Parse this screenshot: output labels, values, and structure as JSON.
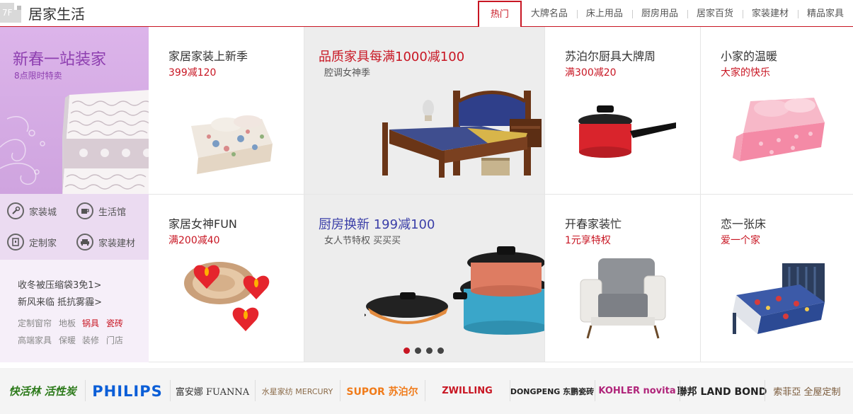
{
  "header": {
    "floor_label": "7F",
    "title": "居家生活",
    "tabs": [
      "热门",
      "大牌名品",
      "床上用品",
      "厨房用品",
      "居家百货",
      "家装建材",
      "精品家具"
    ]
  },
  "left_panel": {
    "banner_title": "新春一站装家",
    "banner_subtitle": "8点限时特卖",
    "icon_links": [
      {
        "label": "家装城",
        "icon": "wrench-icon"
      },
      {
        "label": "生活馆",
        "icon": "cup-icon"
      },
      {
        "label": "定制家",
        "icon": "door-icon"
      },
      {
        "label": "家装建材",
        "icon": "sofa-icon"
      }
    ],
    "promo_links": [
      "收冬被压缩袋3免1>",
      "新风来临 抵抗雾霾>"
    ],
    "small_links": [
      {
        "label": "定制窗帘",
        "highlight": false
      },
      {
        "label": "地板",
        "highlight": false
      },
      {
        "label": "锅具",
        "highlight": true
      },
      {
        "label": "瓷砖",
        "highlight": true
      },
      {
        "label": "高端家具",
        "highlight": false
      },
      {
        "label": "保暖",
        "highlight": false
      },
      {
        "label": "装修",
        "highlight": false
      },
      {
        "label": "门店",
        "highlight": false
      }
    ]
  },
  "products": {
    "bedding_promo": {
      "title": "家居家装上新季",
      "subtitle": "399减120",
      "image": "bedding-image"
    },
    "furniture_promo": {
      "title": "品质家具每满1000减100",
      "subtitle": "腔调女神季",
      "image": "bed-image"
    },
    "supor_promo": {
      "title": "苏泊尔厨具大牌周",
      "subtitle": "满300减20",
      "image": "saucepan-image"
    },
    "home_warm_promo": {
      "title": "小家的温暖",
      "subtitle": "大家的快乐",
      "image": "pink-bedding-image"
    },
    "candle_promo": {
      "title": "家居女神FUN",
      "subtitle": "满200减40",
      "image": "candles-image"
    },
    "kitchen_promo": {
      "title": "厨房换新 199减100",
      "subtitle": "女人节特权 买买买",
      "image": "cookware-image"
    },
    "chair_promo": {
      "title": "开春家装忙",
      "subtitle": "1元享特权",
      "image": "armchair-image"
    },
    "bed_promo": {
      "title": "恋一张床",
      "subtitle": "爱一个家",
      "image": "kids-bed-image"
    }
  },
  "carousel": {
    "total": 4,
    "active_index": 0
  },
  "brands": [
    "快活林 活性炭",
    "PHILIPS",
    "富安娜 FUANNA",
    "水星家纺 MERCURY",
    "SUPOR 苏泊尔",
    "ZWILLING",
    "DONGPENG 东鹏瓷砖",
    "KOHLER novita",
    "聯邦 LAND BOND",
    "索菲亞 全屋定制"
  ],
  "colors": {
    "accent": "#c81623",
    "purple": "#8e3fb0",
    "title_blue": "#3b3fa8",
    "title_red": "#c81623"
  }
}
